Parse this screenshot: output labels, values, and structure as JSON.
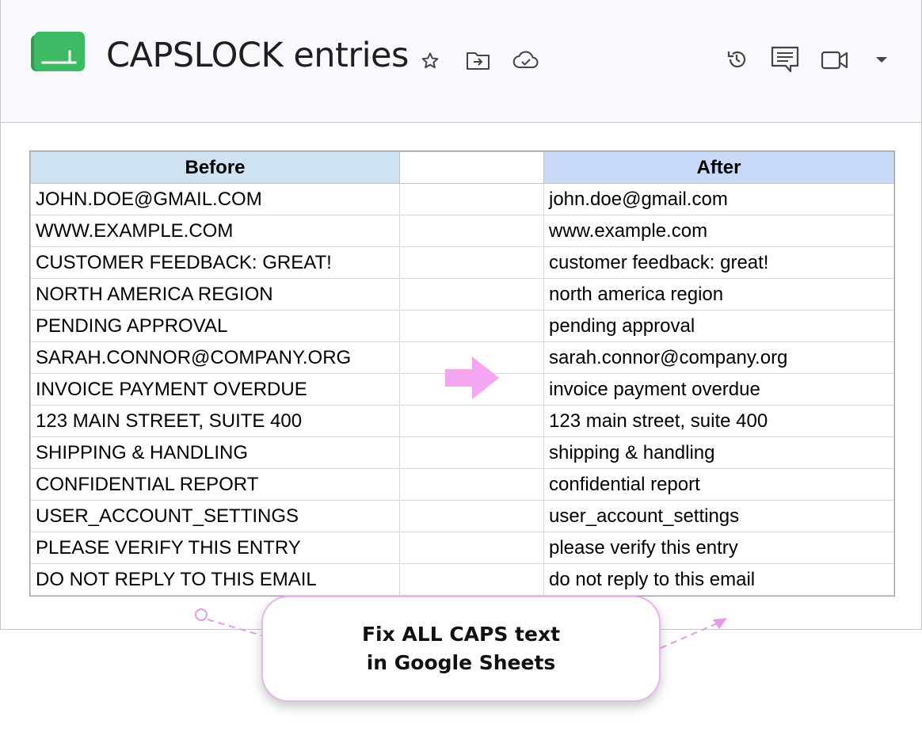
{
  "document": {
    "title": "CAPSLOCK entries"
  },
  "header_icons": [
    "star-icon",
    "move-folder-icon",
    "cloud-saved-icon",
    "version-history-icon",
    "comments-icon",
    "meet-video-icon",
    "dropdown-caret-icon"
  ],
  "table": {
    "headers": {
      "before": "Before",
      "after": "After"
    },
    "rows": [
      {
        "before": "JOHN.DOE@GMAIL.COM",
        "after": "john.doe@gmail.com"
      },
      {
        "before": "WWW.EXAMPLE.COM",
        "after": "www.example.com"
      },
      {
        "before": "CUSTOMER FEEDBACK: GREAT!",
        "after": "customer feedback: great!"
      },
      {
        "before": "NORTH AMERICA REGION",
        "after": "north america region"
      },
      {
        "before": "PENDING APPROVAL",
        "after": "pending approval"
      },
      {
        "before": "SARAH.CONNOR@COMPANY.ORG",
        "after": "sarah.connor@company.org"
      },
      {
        "before": "INVOICE PAYMENT OVERDUE",
        "after": "invoice payment overdue"
      },
      {
        "before": "123 MAIN STREET, SUITE 400",
        "after": "123 main street, suite 400"
      },
      {
        "before": "SHIPPING & HANDLING",
        "after": "shipping & handling"
      },
      {
        "before": "CONFIDENTIAL REPORT",
        "after": "confidential report"
      },
      {
        "before": "USER_ACCOUNT_SETTINGS",
        "after": "user_account_settings"
      },
      {
        "before": "PLEASE VERIFY THIS ENTRY",
        "after": "please verify this entry"
      },
      {
        "before": "DO NOT REPLY TO THIS EMAIL",
        "after": "do not reply to this email"
      }
    ]
  },
  "callout": {
    "line1": "Fix ALL CAPS text",
    "line2": "in Google Sheets"
  },
  "colors": {
    "sheets_green": "#34a853",
    "header_before_bg": "#cfe2f3",
    "header_after_bg": "#c9daf8",
    "arrow_pink": "#f5a6f0",
    "callout_border": "#e8b4ef"
  }
}
